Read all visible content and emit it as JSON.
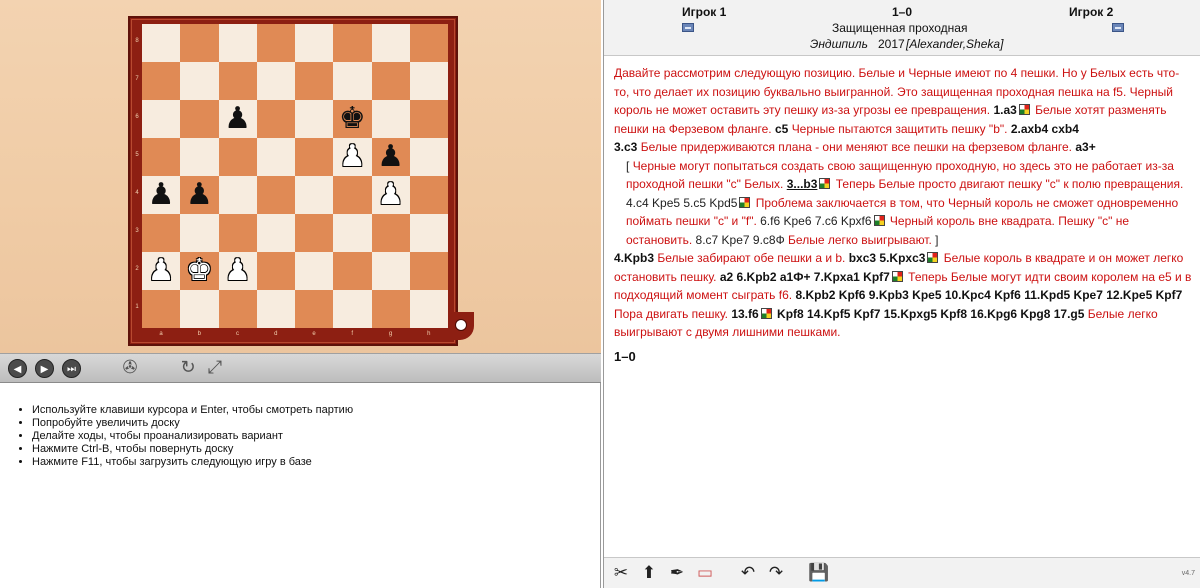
{
  "board": {
    "ranks": [
      "8",
      "7",
      "6",
      "5",
      "4",
      "3",
      "2",
      "1"
    ],
    "files": [
      "a",
      "b",
      "c",
      "d",
      "e",
      "f",
      "g",
      "h"
    ],
    "position": [
      [
        "",
        "",
        "",
        "",
        "",
        "",
        "",
        ""
      ],
      [
        "",
        "",
        "",
        "",
        "",
        "",
        "",
        ""
      ],
      [
        "",
        "",
        "bp",
        "",
        "",
        "bk",
        "",
        ""
      ],
      [
        "",
        "",
        "",
        "",
        "",
        "wp",
        "bp",
        ""
      ],
      [
        "bp",
        "bp",
        "",
        "",
        "",
        "",
        "wp",
        ""
      ],
      [
        "",
        "",
        "",
        "",
        "",
        "",
        "",
        ""
      ],
      [
        "wp",
        "wk",
        "wp",
        "",
        "",
        "",
        "",
        ""
      ],
      [
        "",
        "",
        "",
        "",
        "",
        "",
        "",
        ""
      ]
    ]
  },
  "nav": {
    "back_icon": "◀",
    "forward_icon": "▶",
    "end_icon": "⏭",
    "engine_icon": "✇",
    "flip_icon": "↻",
    "fullscreen_icon": "⤢"
  },
  "hints": [
    "Используйте клавиши курсора и Enter, чтобы смотреть партию",
    "Попробуйте увеличить доску",
    "Делайте ходы, чтобы проанализировать вариант",
    "Нажмите Ctrl-B, чтобы повернуть доску",
    "Нажмите F11, чтобы загрузить следующую игру в базе"
  ],
  "header": {
    "white_player": "Игрок 1",
    "result": "1–0",
    "black_player": "Игрок 2",
    "event": "Защищенная проходная",
    "site": "Эндшпиль",
    "year": "2017",
    "annotator": "[Alexander,Sheka]"
  },
  "moves": {
    "intro": "Давайте рассмотрим следующую позицию. Белые и Черные имеют по 4 пешки. Но у Белых есть что-то, что делает их позицию буквально выигранной. Это защищенная проходная пешка на f5. Черный король не может оставить эту пешку из-за угрозы ее превращения.",
    "m1": "1.a3",
    "c1": "Белые хотят разменять пешки на Ферзевом фланге.",
    "m1b": "c5",
    "c1b": "Черные пытаются защитить пешку \"b\".",
    "m2": "2.axb4",
    "m2b": "cxb4",
    "m3": "3.c3",
    "c3": "Белые придерживаются плана - они меняют все пешки на ферзевом фланге.",
    "m3b": "a3+",
    "var_open": "[",
    "var_c1": "Черные могут попытаться создать свою защищенную проходную, но здесь это не работает из-за проходной пешки \"c\" Белых.",
    "var_m1": "3...b3",
    "var_c2": "Теперь Белые просто двигают пешку \"c\" к полю превращения.",
    "var_m2": "4.c4  Kpe5  5.c5  Kpd5",
    "var_c3": "Проблема заключается в том, что Черный король не сможет одновременно поймать пешки \"c\" и \"f\".",
    "var_m3": "6.f6  Kpe6  7.c6  Kpxf6",
    "var_c4": "Черный король вне квадрата. Пешку \"c\" не остановить.",
    "var_m4": "8.c7  Kpe7  9.c8Ф",
    "var_c5": "Белые легко выигрывают.",
    "var_close": "]",
    "m4": "4.Kpb3",
    "c4": "Белые забирают обе пешки a и b.",
    "m4b": "bxc3",
    "m5": "5.Kpxc3",
    "c5": "Белые король в квадрате и он может легко остановить пешку.",
    "m5b": "a2  6.Kpb2  a1Ф+  7.Kpxa1  Kpf7",
    "c7": "Теперь Белые могут идти своим королем на e5 и в подходящий момент сыграть f6.",
    "m8": "8.Kpb2  Kpf6  9.Kpb3  Kpe5  10.Kpc4  Kpf6  11.Kpd5  Kpe7  12.Kpe5  Kpf7",
    "c12": "Пора двигать пешку.",
    "m13": "13.f6",
    "m13b": "Kpf8  14.Kpf5  Kpf7  15.Kpxg5  Kpf8  16.Kpg6  Kpg8  17.g5",
    "c17": "Белые легко выигрывают с двумя лишними пешками.",
    "final_result": "1–0"
  },
  "toolbar": {
    "cut_icon": "✂",
    "promote_icon": "⬆",
    "pen_icon": "✒",
    "eraser_icon": "▭",
    "undo_icon": "↶",
    "redo_icon": "↷",
    "save_icon": "💾",
    "version": "v4.7"
  }
}
